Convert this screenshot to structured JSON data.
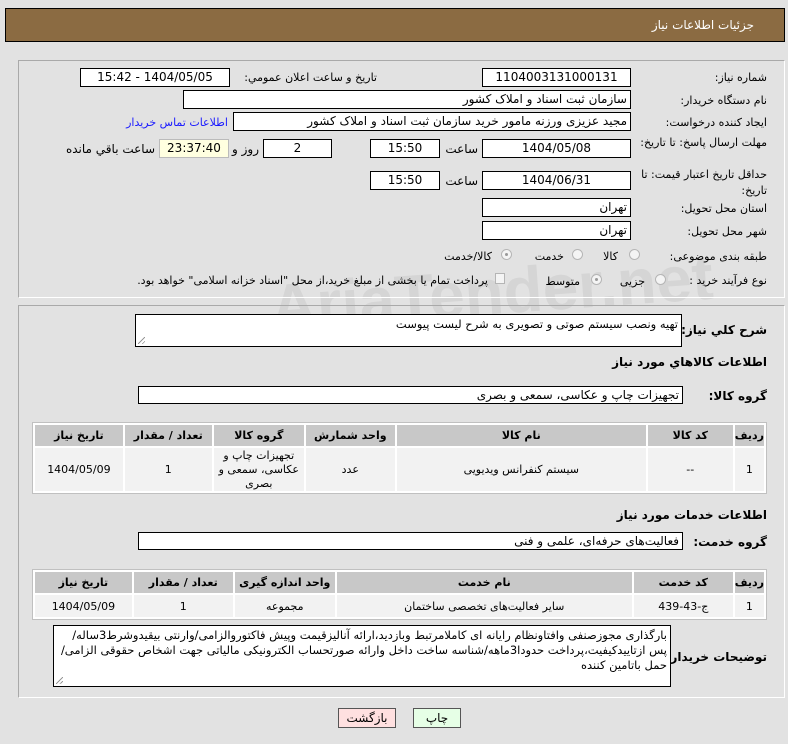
{
  "header": {
    "title": "جزئیات اطلاعات نیاز"
  },
  "watermark": "AriaTender.net",
  "form": {
    "need_number_label": "شماره نیاز:",
    "need_number": "1104003131000131",
    "announce_label": "تاریخ و ساعت اعلان عمومي:",
    "announce_value": "1404/05/05 - 15:42",
    "buyer_org_label": "نام دستگاه خريدار:",
    "buyer_org": "سازمان ثبت اسناد و املاک کشور",
    "creator_label": "ایجاد کننده درخواست:",
    "creator": "مجید عزیزی ورزنه مامور خرید سازمان ثبت اسناد و املاک کشور",
    "contact_link": "اطلاعات تماس خریدار",
    "deadline_label": "مهلت ارسال پاسخ: تا تاریخ:",
    "deadline_date": "1404/05/08",
    "time_label": "ساعت",
    "deadline_time": "15:50",
    "days": "2",
    "days_label": "روز و",
    "remaining": "23:37:40",
    "remaining_label": "ساعت باقي مانده",
    "validity_label": "حداقل تاریخ اعتبار قیمت: تا تاریخ:",
    "validity_date": "1404/06/31",
    "validity_time": "15:50",
    "province_label": "استان محل تحویل:",
    "province": "تهران",
    "city_label": "شهر محل تحویل:",
    "city": "تهران",
    "category_label": "طبقه بندی موضوعی:",
    "category_options": [
      "کالا",
      "خدمت",
      "کالا/خدمت"
    ],
    "category_selected": "کالا/خدمت",
    "process_label": "نوع فرآیند خرید :",
    "process_options": [
      "جزیی",
      "متوسط"
    ],
    "process_selected": "متوسط",
    "treasury_text": "پرداخت تمام یا بخشی از مبلغ خرید،از محل \"اسناد خزانه اسلامی\" خواهد بود."
  },
  "summary": {
    "label": "شرح کلي نیاز:",
    "value": "تهیه ونصب سیستم صوتی و تصویری به شرح لیست پیوست"
  },
  "goods": {
    "heading": "اطلاعات کالاهاي مورد نیاز",
    "group_label": "گروه کالا:",
    "group": "تجهیزات چاپ و عکاسی، سمعی و بصری",
    "columns": [
      "ردیف",
      "کد کالا",
      "نام کالا",
      "واحد شمارش",
      "گروه کالا",
      "تعداد / مقدار",
      "تاریخ نیاز"
    ],
    "rows": [
      [
        "1",
        "--",
        "سیستم کنفرانس ویدیویی",
        "عدد",
        "تجهیزات چاپ و عکاسی، سمعی و بصری",
        "1",
        "1404/05/09"
      ]
    ]
  },
  "services": {
    "heading": "اطلاعات خدمات مورد نیاز",
    "group_label": "گروه خدمت:",
    "group": "فعالیت‌های حرفه‌ای، علمی و فنی",
    "columns": [
      "ردیف",
      "کد خدمت",
      "نام خدمت",
      "واحد اندازه گیری",
      "تعداد / مقدار",
      "تاریخ نیاز"
    ],
    "rows": [
      [
        "1",
        "ج-43-439",
        "سایر فعالیت‌های تخصصی ساختمان",
        "مجموعه",
        "1",
        "1404/05/09"
      ]
    ]
  },
  "notes": {
    "label": "توضیحات خریدار:",
    "value": "بارگذاری مجوزصنفی وافتاونظام رایانه ای کاملامرتبط وبازدید،ارائه آنالیزقیمت وپیش فاکتوروالزامی/وارنتی بیقیدوشرط3ساله/پس ازتاییدکیفیت،پرداخت حدودا3ماهه/شناسه ساخت داخل وارائه صورتحساب الکترونیکی مالیاتی جهت اشخاص حقوقی الزامی/حمل باتامین کننده"
  },
  "buttons": {
    "print": "چاپ",
    "back": "بازگشت"
  },
  "colors": {
    "header": "#8b6b42",
    "link": "#1a1aff",
    "print_bg": "#e6ffe6",
    "back_bg": "#ffe0e0",
    "remaining_bg": "#ffffe0"
  }
}
